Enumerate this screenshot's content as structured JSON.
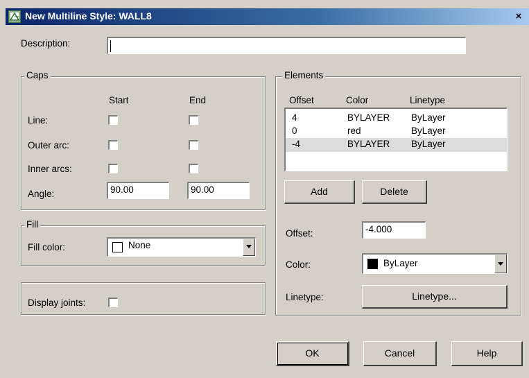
{
  "window": {
    "title": "New Multiline Style: WALL8",
    "close_label": "×"
  },
  "description": {
    "label": "Description:",
    "value": ""
  },
  "caps": {
    "title": "Caps",
    "col_start": "Start",
    "col_end": "End",
    "rows": [
      {
        "label": "Line:",
        "start_checked": false,
        "end_checked": false
      },
      {
        "label": "Outer arc:",
        "start_checked": false,
        "end_checked": false
      },
      {
        "label": "Inner arcs:",
        "start_checked": false,
        "end_checked": false
      }
    ],
    "angle_label": "Angle:",
    "angle_start": "90.00",
    "angle_end": "90.00"
  },
  "fill": {
    "title": "Fill",
    "color_label": "Fill color:",
    "color_value": "None",
    "swatch_color": "#ffffff"
  },
  "display_joints": {
    "label": "Display joints:",
    "checked": false
  },
  "elements": {
    "title": "Elements",
    "headers": [
      "Offset",
      "Color",
      "Linetype"
    ],
    "rows": [
      {
        "offset": "4",
        "color": "BYLAYER",
        "linetype": "ByLayer",
        "selected": false
      },
      {
        "offset": "0",
        "color": "red",
        "linetype": "ByLayer",
        "selected": false
      },
      {
        "offset": "-4",
        "color": "BYLAYER",
        "linetype": "ByLayer",
        "selected": true
      }
    ],
    "add_label": "Add",
    "delete_label": "Delete",
    "offset_label": "Offset:",
    "offset_value": "-4.000",
    "color_label": "Color:",
    "color_value": "ByLayer",
    "color_swatch": "#000000",
    "linetype_label": "Linetype:",
    "linetype_button": "Linetype..."
  },
  "buttons": {
    "ok": "OK",
    "cancel": "Cancel",
    "help": "Help"
  }
}
